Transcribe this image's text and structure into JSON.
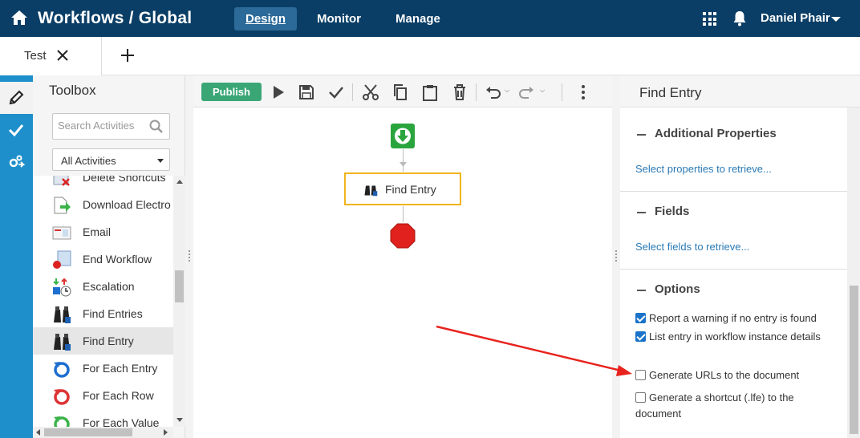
{
  "header": {
    "title": "Workflows / Global",
    "nav": [
      {
        "label": "Design",
        "active": true
      },
      {
        "label": "Monitor",
        "active": false
      },
      {
        "label": "Manage",
        "active": false
      }
    ],
    "user_name": "Daniel Phair"
  },
  "tabs": {
    "open": [
      {
        "label": "Test"
      }
    ]
  },
  "rail": {
    "items": [
      {
        "icon": "pencil-icon",
        "active": true
      },
      {
        "icon": "check-icon",
        "active": false
      },
      {
        "icon": "gears-arrow-icon",
        "active": false
      }
    ]
  },
  "toolbox": {
    "title": "Toolbox",
    "search_placeholder": "Search Activities",
    "filter_value": "All Activities",
    "activities": [
      {
        "label": "Delete Shortcuts",
        "icon": "delete-shortcuts-icon"
      },
      {
        "label": "Download Electro",
        "icon": "download-icon"
      },
      {
        "label": "Email",
        "icon": "email-icon"
      },
      {
        "label": "End Workflow",
        "icon": "end-workflow-icon"
      },
      {
        "label": "Escalation",
        "icon": "escalation-icon"
      },
      {
        "label": "Find Entries",
        "icon": "binoculars-icon"
      },
      {
        "label": "Find Entry",
        "icon": "binoculars-icon",
        "selected": true
      },
      {
        "label": "For Each Entry",
        "icon": "loop-icon"
      },
      {
        "label": "For Each Row",
        "icon": "loop-icon"
      },
      {
        "label": "For Each Value",
        "icon": "loop-icon"
      }
    ]
  },
  "designer": {
    "publish_label": "Publish",
    "node_label": "Find Entry"
  },
  "properties": {
    "title": "Find Entry",
    "sections": {
      "additional": {
        "title": "Additional Properties",
        "link": "Select properties to retrieve..."
      },
      "fields": {
        "title": "Fields",
        "link": "Select fields to retrieve..."
      },
      "options": {
        "title": "Options",
        "items": [
          {
            "label": "Report a warning if no entry is found",
            "checked": true
          },
          {
            "label": "List entry in workflow instance details",
            "checked": true
          },
          {
            "label": "Generate URLs to the document",
            "checked": false
          },
          {
            "label": "Generate a shortcut (.lfe) to the document",
            "checked": false
          }
        ]
      }
    }
  },
  "colors": {
    "header_bg": "#0a3e66",
    "rail_bg": "#1e8fcb",
    "publish_bg": "#3aa676",
    "selected_node_border": "#f0b41c",
    "link": "#2a7ab5",
    "annotation_arrow": "#e8231d"
  }
}
